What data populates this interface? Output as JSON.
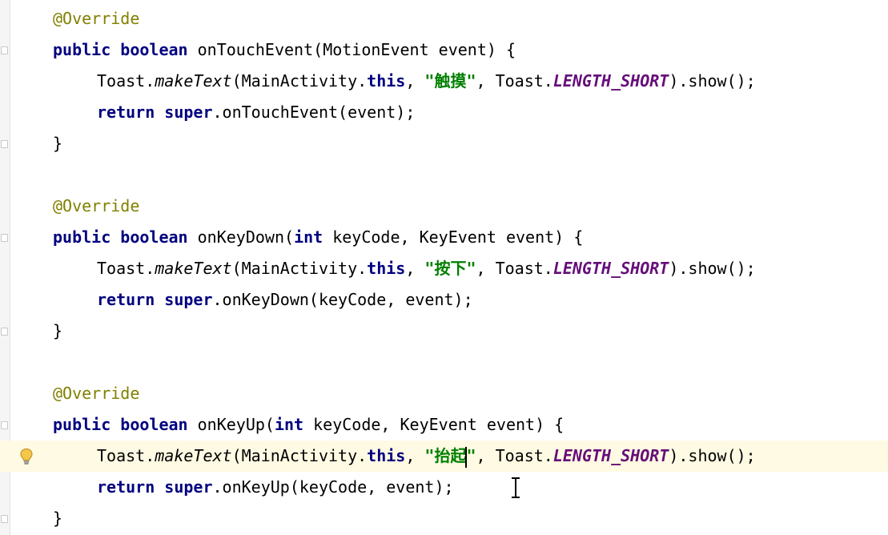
{
  "editor": {
    "lines": [
      {
        "t": "annotation",
        "text": "@Override"
      },
      {
        "t": "decl",
        "kw1": "public",
        "kw2": "boolean",
        "name": "onTouchEvent",
        "params_open": "(",
        "params_a": "MotionEvent event",
        "params_close": ") {"
      },
      {
        "t": "toast",
        "prefix": "Toast.",
        "method": "makeText",
        "open": "(MainActivity.",
        "this_kw": "this",
        "comma1": ", ",
        "str": "\"触摸\"",
        "comma2": ", Toast.",
        "field": "LENGTH_SHORT",
        "tail": ").show();"
      },
      {
        "t": "ret",
        "kw1": "return",
        "kw2": "super",
        "call": ".onTouchEvent(event);"
      },
      {
        "t": "brace",
        "text": "}"
      },
      {
        "t": "annotation",
        "text": "@Override"
      },
      {
        "t": "decl2",
        "kw1": "public",
        "kw2": "boolean",
        "name": "onKeyDown(",
        "int_kw": "int",
        "rest": " keyCode, KeyEvent event) {"
      },
      {
        "t": "toast",
        "prefix": "Toast.",
        "method": "makeText",
        "open": "(MainActivity.",
        "this_kw": "this",
        "comma1": ", ",
        "str": "\"按下\"",
        "comma2": ", Toast.",
        "field": "LENGTH_SHORT",
        "tail": ").show();"
      },
      {
        "t": "ret",
        "kw1": "return",
        "kw2": "super",
        "call": ".onKeyDown(keyCode, event);"
      },
      {
        "t": "brace",
        "text": "}"
      },
      {
        "t": "annotation",
        "text": "@Override"
      },
      {
        "t": "decl2",
        "kw1": "public",
        "kw2": "boolean",
        "name": "onKeyUp(",
        "int_kw": "int",
        "rest": " keyCode, KeyEvent event) {"
      },
      {
        "t": "toast",
        "prefix": "Toast.",
        "method": "makeText",
        "open": "(MainActivity.",
        "this_kw": "this",
        "comma1": ", ",
        "str_a": "\"抬起",
        "str_b": "\"",
        "comma2": ", Toast.",
        "field": "LENGTH_SHORT",
        "tail": ").show();"
      },
      {
        "t": "ret",
        "kw1": "return",
        "kw2": "super",
        "call": ".onKeyUp(keyCode, event);"
      },
      {
        "t": "brace",
        "text": "}"
      }
    ]
  },
  "colors": {
    "annotation": "#808000",
    "keyword": "#000080",
    "string": "#008000",
    "static_field": "#660e7a",
    "current_line": "#fffae3"
  },
  "icons": {
    "intention": "lightbulb-icon",
    "mouse_cursor": "text-cursor-icon"
  }
}
